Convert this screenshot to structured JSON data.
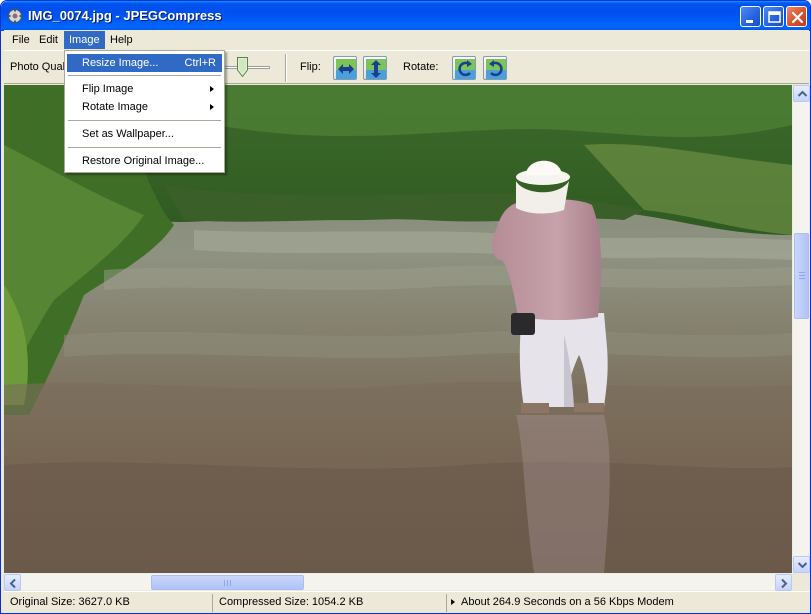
{
  "window": {
    "title": "IMG_0074.jpg - JPEGCompress"
  },
  "menubar": {
    "items": [
      {
        "label": "File"
      },
      {
        "label": "Edit"
      },
      {
        "label": "Image"
      },
      {
        "label": "Help"
      }
    ]
  },
  "toolbar": {
    "quality_label": "Photo Qual",
    "flip_label": "Flip:",
    "rotate_label": "Rotate:",
    "icons": [
      "flip-horizontal-icon",
      "flip-vertical-icon",
      "rotate-left-icon",
      "rotate-right-icon"
    ]
  },
  "image_menu": {
    "items": [
      {
        "label": "Resize Image...",
        "shortcut": "Ctrl+R",
        "highlighted": true
      },
      {
        "label": "Flip Image",
        "submenu": true
      },
      {
        "label": "Rotate Image",
        "submenu": true
      },
      {
        "label": "Set as Wallpaper..."
      },
      {
        "label": "Restore Original Image..."
      }
    ]
  },
  "statusbar": {
    "original_size": "Original Size: 3627.0 KB",
    "compressed_size": "Compressed Size: 1054.2 KB",
    "transfer_time": "About 264.9 Seconds on a 56 Kbps Modem"
  },
  "colors": {
    "titlebar": "#0055ea",
    "menu_highlight": "#316ac5",
    "window_face": "#ece9d8"
  }
}
